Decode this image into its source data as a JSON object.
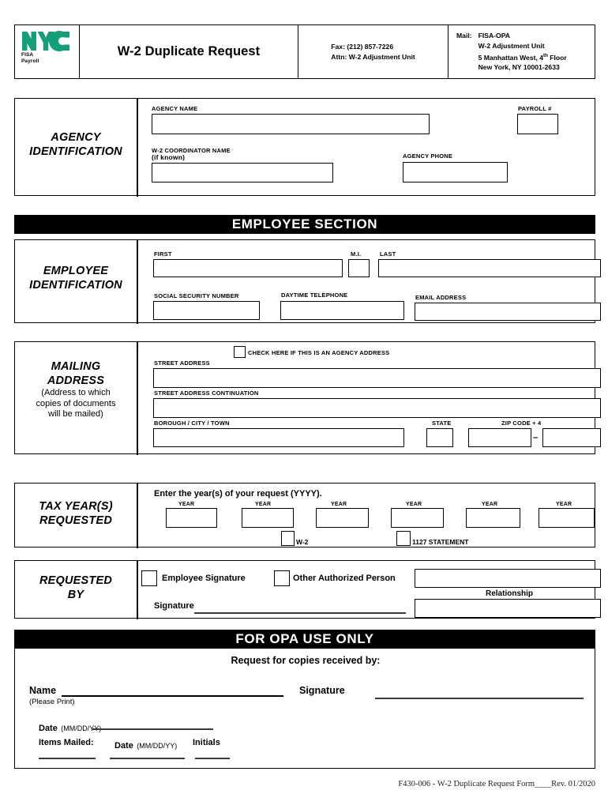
{
  "header": {
    "logo": {
      "nyc": "NYC",
      "line1": "FISA",
      "line2": "Payroll"
    },
    "title": "W-2 Duplicate Request",
    "fax": {
      "line1": "Fax:  (212) 857-7226",
      "line2": "Attn: W-2 Adjustment Unit"
    },
    "mail": {
      "label": "Mail:",
      "line1": "FISA-OPA",
      "line2": "W-2 Adjustment Unit",
      "line3_pre": "5 Manhattan West, 4",
      "line3_sup": "th",
      "line3_post": " Floor",
      "line4": "New York,  NY  10001-2633"
    }
  },
  "agency": {
    "title_line1": "AGENCY",
    "title_line2": "IDENTIFICATION",
    "agency_name_label": "AGENCY NAME",
    "agency_name_value": "",
    "payroll_label": "PAYROLL #",
    "payroll_value": "",
    "coordinator_label_line1": "W-2 COORDINATOR NAME",
    "coordinator_label_line2": "(if known)",
    "coordinator_value": "",
    "agency_phone_label": "AGENCY PHONE",
    "agency_phone_value": ""
  },
  "employee_section": {
    "banner": "EMPLOYEE SECTION"
  },
  "employee_id": {
    "title_line1": "EMPLOYEE",
    "title_line2": "IDENTIFICATION",
    "first_label": "FIRST",
    "first_value": "",
    "mi_label": "M.I.",
    "mi_value": "",
    "last_label": "LAST",
    "last_value": "",
    "ssn_label": "SOCIAL SECURITY NUMBER",
    "ssn_value": "",
    "phone_label": "DAYTIME TELEPHONE",
    "phone_value": "",
    "email_label": "EMAIL ADDRESS",
    "email_value": ""
  },
  "mailing": {
    "title_line1": "MAILING",
    "title_line2": "ADDRESS",
    "sub_line1": "(Address to which",
    "sub_line2": "copies of documents",
    "sub_line3": "will be mailed)",
    "agency_address_checkbox_label": "CHECK HERE IF THIS IS AN AGENCY ADDRESS",
    "agency_address_checked": false,
    "street_label": "STREET ADDRESS",
    "street_value": "",
    "street2_label": "STREET ADDRESS CONTINUATION",
    "street2_value": "",
    "city_label": "BOROUGH / CITY / TOWN",
    "city_value": "",
    "state_label": "STATE",
    "state_value": "",
    "zip_label": "ZIP CODE + 4",
    "zip_value": "",
    "zip_separator": "–",
    "zip4_value": ""
  },
  "tax_years": {
    "title_line1": "TAX YEAR(S)",
    "title_line2": "REQUESTED",
    "instruction": "Enter the year(s) of your request (YYYY).",
    "year_label": "YEAR",
    "years": [
      "",
      "",
      "",
      "",
      "",
      ""
    ],
    "w2_label": "W-2",
    "w2_checked": false,
    "stmt_label": "1127 STATEMENT",
    "stmt_checked": false
  },
  "requested_by": {
    "title_line1": "REQUESTED",
    "title_line2": "BY",
    "employee_sig_label": "Employee Signature",
    "employee_sig_checked": false,
    "other_person_label": "Other Authorized Person",
    "other_person_checked": false,
    "other_person_value": "",
    "relationship_label": "Relationship",
    "relationship_value": "",
    "signature_label": "Signature",
    "signature_value": ""
  },
  "opa": {
    "banner": "FOR OPA USE ONLY",
    "received_by": "Request for copies received by:",
    "name_label": "Name",
    "name_value": "",
    "please_print": "(Please Print)",
    "signature_label": "Signature",
    "signature_value": "",
    "date_label": "Date",
    "date_format": "(MM/DD/YY)",
    "date_value": "",
    "items_mailed_label": "Items Mailed:",
    "items_date_label": "Date",
    "items_date_format": "(MM/DD/YY)",
    "items_date_value": "",
    "initials_label": "Initials",
    "initials_value": "",
    "items_mailed_value": ""
  },
  "footer": {
    "text": "F430-006 - W-2 Duplicate Request Form____Rev. 01/2020"
  },
  "colors": {
    "nyc_green": "#169E7A",
    "banner_bg": "#000000",
    "banner_text": "#FFFFFF",
    "border": "#000000"
  }
}
